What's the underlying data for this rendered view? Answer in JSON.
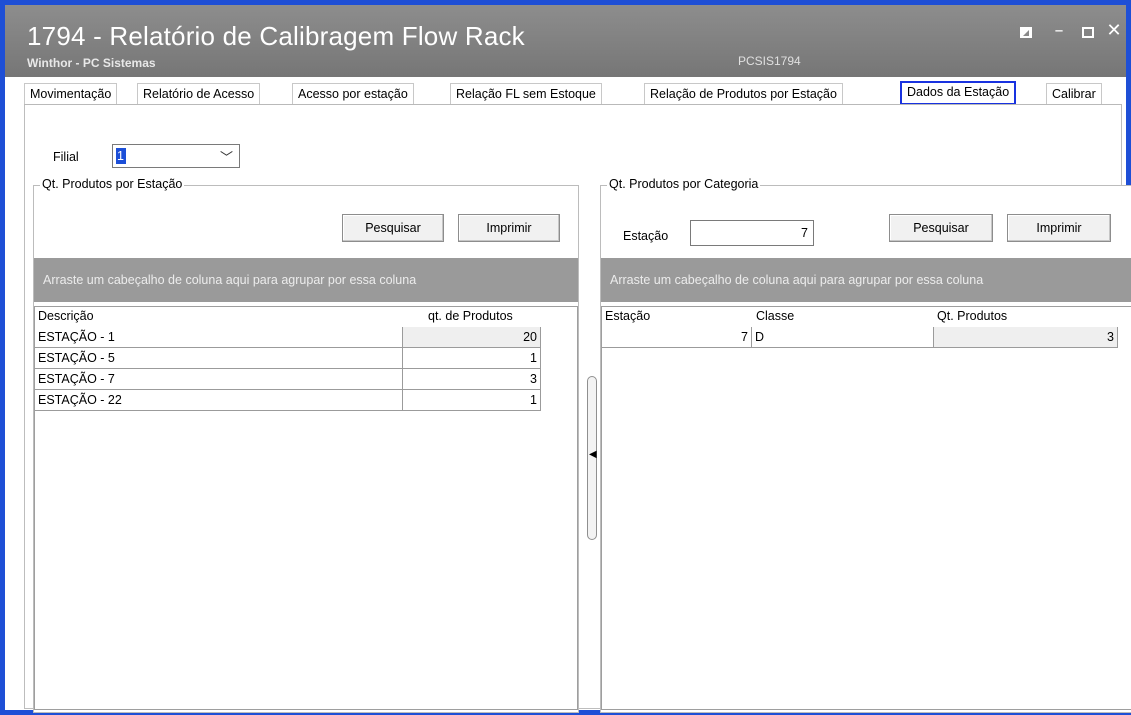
{
  "window": {
    "title": "1794 - Relatório de Calibragem Flow Rack",
    "subtitle": "Winthor - PC Sistemas",
    "app_code": "PCSIS1794",
    "controls": {
      "restore": "restore-icon",
      "minimize": "minimize-icon",
      "maximize": "maximize-icon",
      "close": "close-icon"
    }
  },
  "tabs": [
    {
      "label": "Movimentação"
    },
    {
      "label": "Relatório de Acesso"
    },
    {
      "label": "Acesso por estação"
    },
    {
      "label": "Relação FL sem Estoque"
    },
    {
      "label": "Relação de Produtos por Estação"
    },
    {
      "label": "Dados da Estação",
      "active": true
    },
    {
      "label": "Calibrar"
    }
  ],
  "filial": {
    "label": "Filial",
    "value": "1"
  },
  "left_panel": {
    "title": "Qt. Produtos por Estação",
    "search_button": "Pesquisar",
    "print_button": "Imprimir",
    "group_hint": "Arraste um cabeçalho de coluna aqui para agrupar por essa coluna",
    "columns": [
      "Descrição",
      "qt. de Produtos"
    ],
    "rows": [
      {
        "descricao": "ESTAÇÃO - 1",
        "qt": "20"
      },
      {
        "descricao": "ESTAÇÃO - 5",
        "qt": "1"
      },
      {
        "descricao": "ESTAÇÃO - 7",
        "qt": "3"
      },
      {
        "descricao": "ESTAÇÃO - 22",
        "qt": "1"
      }
    ]
  },
  "right_panel": {
    "title": "Qt. Produtos por Categoria",
    "station_label": "Estação",
    "station_value": "7",
    "search_button": "Pesquisar",
    "print_button": "Imprimir",
    "group_hint": "Arraste um cabeçalho de coluna aqui para agrupar por essa coluna",
    "columns": [
      "Estação",
      "Classe",
      "Qt. Produtos"
    ],
    "rows": [
      {
        "estacao": "7",
        "classe": "D",
        "qt": "3"
      }
    ]
  },
  "colors": {
    "accent": "#1832e0",
    "titlebar": "#808080",
    "group_area": "#9a9a9a",
    "selection": "#1c4fd8"
  }
}
